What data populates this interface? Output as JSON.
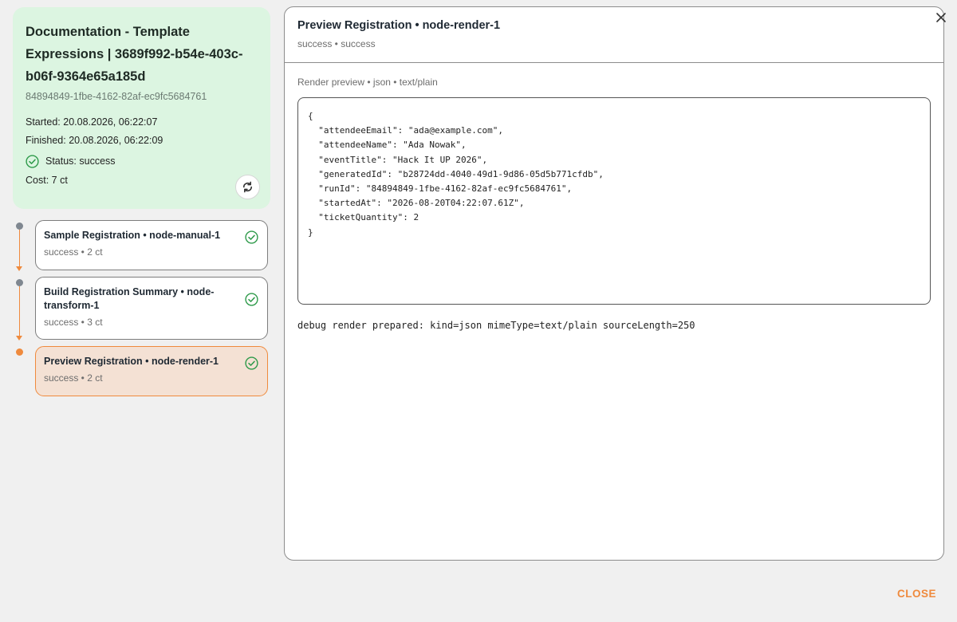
{
  "summary": {
    "title": "Documentation - Template Expressions | 3689f992-b54e-403c-b06f-9364e65a185d",
    "id": "84894849-1fbe-4162-82af-ec9fc5684761",
    "started": "Started: 20.08.2026, 06:22:07",
    "finished": "Finished: 20.08.2026, 06:22:09",
    "status": "Status: success",
    "cost": "Cost: 7 ct"
  },
  "nodes": [
    {
      "title": "Sample Registration • node-manual-1",
      "sub": "success • 2 ct"
    },
    {
      "title": "Build Registration Summary • node-transform-1",
      "sub": "success • 3 ct"
    },
    {
      "title": "Preview Registration • node-render-1",
      "sub": "success • 2 ct"
    }
  ],
  "panel": {
    "title": "Preview Registration • node-render-1",
    "subtitle": "success • success",
    "preview_label": "Render preview • json • text/plain",
    "code": "{\n  \"attendeeEmail\": \"ada@example.com\",\n  \"attendeeName\": \"Ada Nowak\",\n  \"eventTitle\": \"Hack It UP 2026\",\n  \"generatedId\": \"b28724dd-4040-49d1-9d86-05d5b771cfdb\",\n  \"runId\": \"84894849-1fbe-4162-82af-ec9fc5684761\",\n  \"startedAt\": \"2026-08-20T04:22:07.61Z\",\n  \"ticketQuantity\": 2\n}",
    "debug": "debug render prepared: kind=json mimeType=text/plain sourceLength=250"
  },
  "footer": {
    "close_label": "CLOSE"
  },
  "colors": {
    "accent": "#ef8a3d",
    "success": "#2e9a4a",
    "summary_bg": "#dcf5e1",
    "active_bg": "#f4e1d4"
  },
  "icons": {
    "status": "check-circle-icon",
    "refresh": "refresh-icon",
    "close": "close-icon"
  }
}
